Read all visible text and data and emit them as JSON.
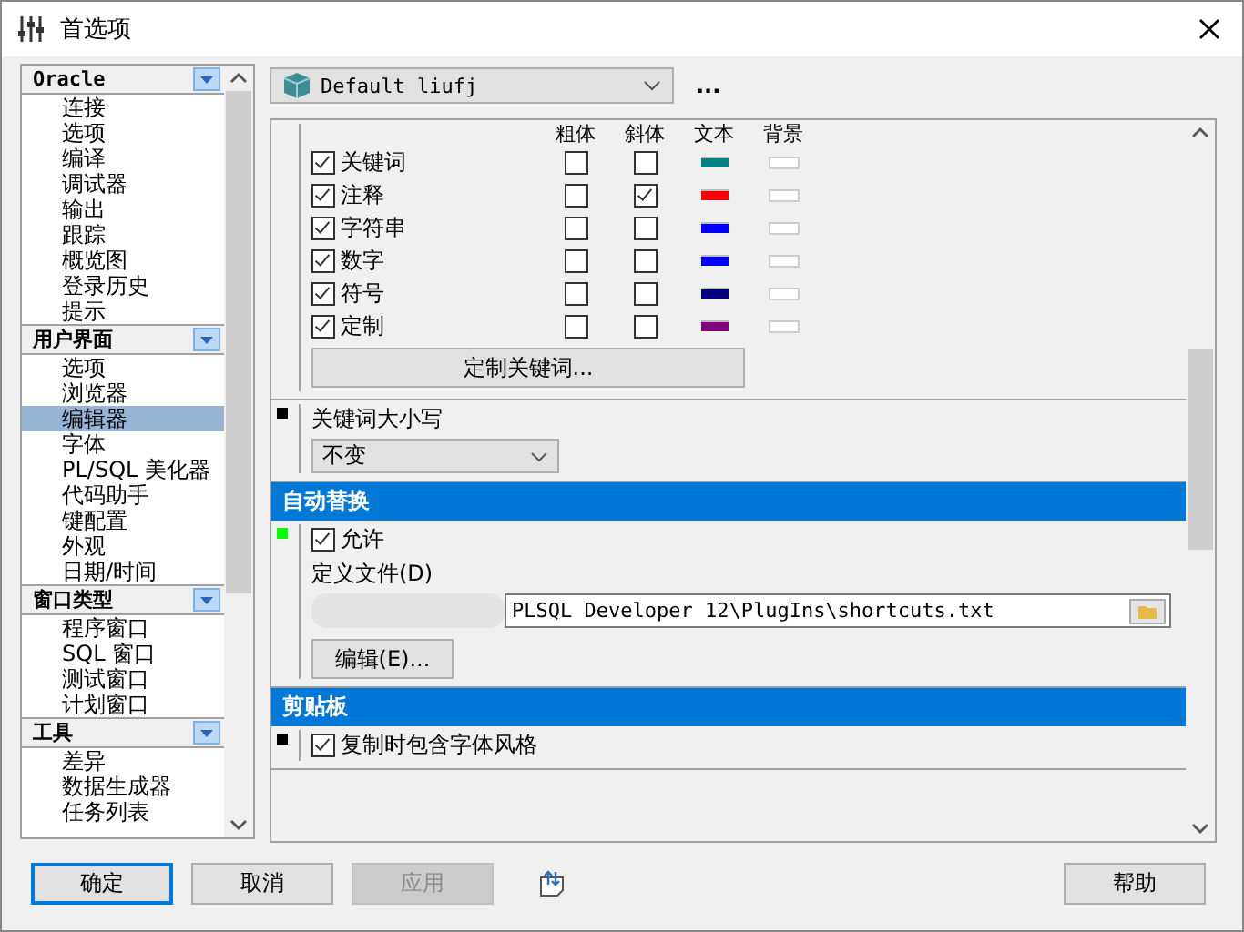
{
  "window": {
    "title": "首选项"
  },
  "sidebar": {
    "groups": [
      {
        "title": "Oracle",
        "items": [
          {
            "label": "连接",
            "selected": false
          },
          {
            "label": "选项",
            "selected": false
          },
          {
            "label": "编译",
            "selected": false
          },
          {
            "label": "调试器",
            "selected": false
          },
          {
            "label": "输出",
            "selected": false
          },
          {
            "label": "跟踪",
            "selected": false
          },
          {
            "label": "概览图",
            "selected": false
          },
          {
            "label": "登录历史",
            "selected": false
          },
          {
            "label": "提示",
            "selected": false
          }
        ]
      },
      {
        "title": "用户界面",
        "items": [
          {
            "label": "选项",
            "selected": false
          },
          {
            "label": "浏览器",
            "selected": false
          },
          {
            "label": "编辑器",
            "selected": true
          },
          {
            "label": "字体",
            "selected": false
          },
          {
            "label": "PL/SQL 美化器",
            "selected": false
          },
          {
            "label": "代码助手",
            "selected": false
          },
          {
            "label": "键配置",
            "selected": false
          },
          {
            "label": "外观",
            "selected": false
          },
          {
            "label": "日期/时间",
            "selected": false
          }
        ]
      },
      {
        "title": "窗口类型",
        "items": [
          {
            "label": "程序窗口",
            "selected": false
          },
          {
            "label": "SQL 窗口",
            "selected": false
          },
          {
            "label": "测试窗口",
            "selected": false
          },
          {
            "label": "计划窗口",
            "selected": false
          }
        ]
      },
      {
        "title": "工具",
        "items": [
          {
            "label": "差异",
            "selected": false
          },
          {
            "label": "数据生成器",
            "selected": false
          },
          {
            "label": "任务列表",
            "selected": false
          }
        ]
      }
    ]
  },
  "profile": {
    "value": "Default liufj",
    "more": "..."
  },
  "sections": [
    {
      "kind": "syntax",
      "columns": [
        "粗体",
        "斜体",
        "文本",
        "背景"
      ],
      "rows": [
        {
          "label": "关键词",
          "checked": true,
          "bold": false,
          "italic": false,
          "color": "#008080"
        },
        {
          "label": "注释",
          "checked": true,
          "bold": false,
          "italic": true,
          "color": "#ff0000"
        },
        {
          "label": "字符串",
          "checked": true,
          "bold": false,
          "italic": false,
          "color": "#0000ff"
        },
        {
          "label": "数字",
          "checked": true,
          "bold": false,
          "italic": false,
          "color": "#0000ff"
        },
        {
          "label": "符号",
          "checked": true,
          "bold": false,
          "italic": false,
          "color": "#000080"
        },
        {
          "label": "定制",
          "checked": true,
          "bold": false,
          "italic": false,
          "color": "#800080"
        }
      ],
      "button": "定制关键词..."
    },
    {
      "kind": "select",
      "color": "#000000",
      "label": "关键词大小写",
      "value": "不变"
    },
    {
      "kind": "header",
      "title": "自动替换"
    },
    {
      "kind": "file",
      "color": "#00ff00",
      "checkbox": {
        "label": "允许",
        "checked": true
      },
      "file_label": "定义文件(D)",
      "file_value": "PLSQL Developer 12\\PlugIns\\shortcuts.txt",
      "button": "编辑(E)..."
    },
    {
      "kind": "header",
      "title": "剪贴板"
    },
    {
      "kind": "check",
      "color": "#000000",
      "checkbox": {
        "label": "复制时包含字体风格",
        "checked": true
      }
    }
  ],
  "buttons": [
    {
      "label": "确定",
      "disabled": false,
      "default": true
    },
    {
      "label": "取消",
      "disabled": false,
      "default": false
    },
    {
      "label": "应用",
      "disabled": true,
      "default": false
    }
  ],
  "help_button": "帮助"
}
